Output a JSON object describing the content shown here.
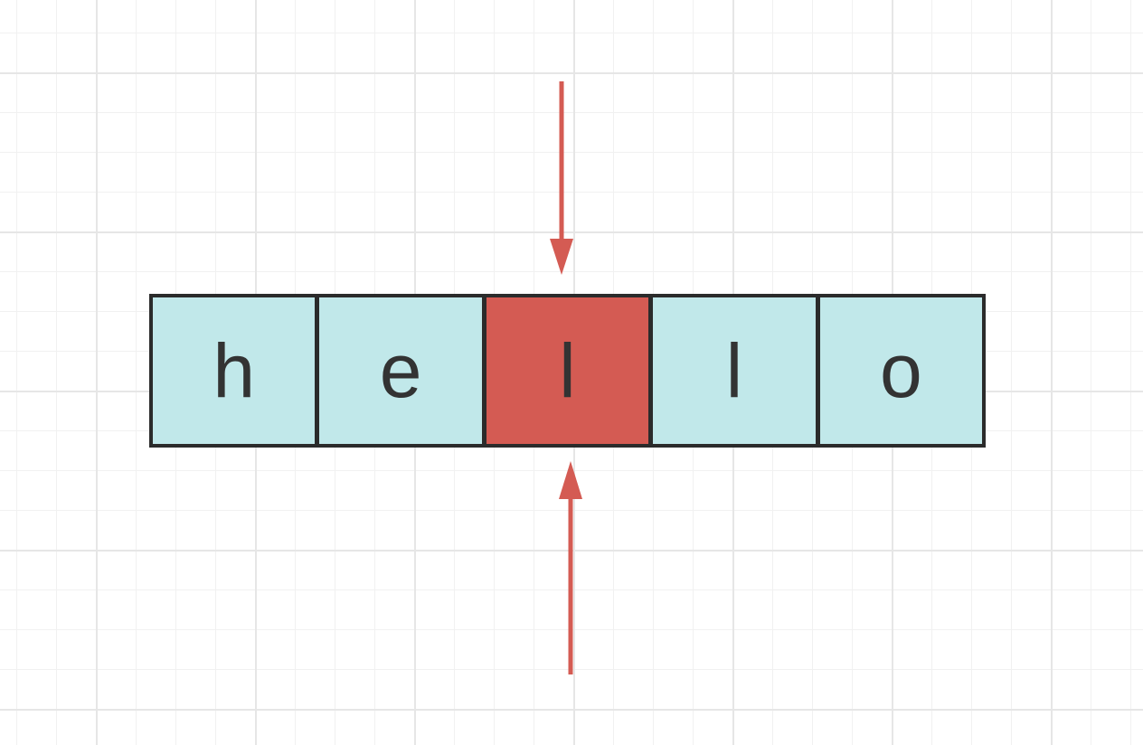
{
  "colors": {
    "cell_fill": "#c1e8ea",
    "highlight_fill": "#d45b53",
    "border": "#2b2b2b",
    "arrow": "#d45b53"
  },
  "array": {
    "cells": [
      {
        "char": "h",
        "highlighted": false
      },
      {
        "char": "e",
        "highlighted": false
      },
      {
        "char": "l",
        "highlighted": true
      },
      {
        "char": "l",
        "highlighted": false
      },
      {
        "char": "o",
        "highlighted": false
      }
    ]
  },
  "pointers": [
    {
      "name": "top-pointer",
      "direction": "down",
      "target_index": 2
    },
    {
      "name": "bottom-pointer",
      "direction": "up",
      "target_index": 2
    }
  ]
}
